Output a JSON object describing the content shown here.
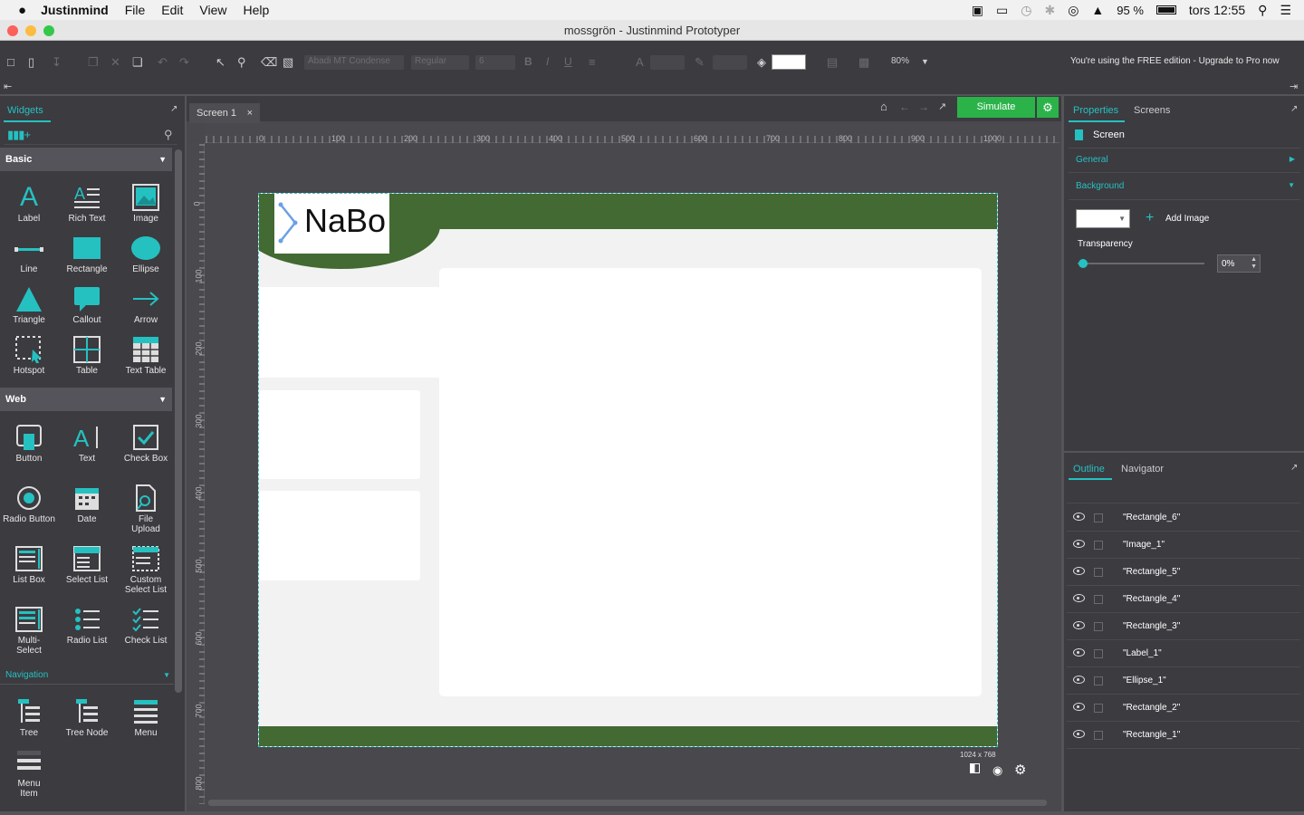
{
  "menubar": {
    "apple_icon": "apple-icon",
    "app": "Justinmind",
    "items": [
      "File",
      "Edit",
      "View",
      "Help"
    ],
    "battery": "95 %",
    "clock": "tors 12:55"
  },
  "window": {
    "title": "mossgrön - Justinmind Prototyper"
  },
  "toolbar": {
    "font_family": "Abadi MT Condense",
    "font_style": "Regular",
    "font_size": "6",
    "bold": "B",
    "italic": "I",
    "underline": "U",
    "font_color_glyph": "A",
    "zoom": "80%",
    "edition_notice": "You're using the FREE edition - Upgrade to Pro now"
  },
  "left_panel": {
    "tab": "Widgets",
    "sections": {
      "basic": "Basic",
      "web": "Web",
      "navigation": "Navigation"
    },
    "basic_widgets": [
      "Label",
      "Rich Text",
      "Image",
      "Line",
      "Rectangle",
      "Ellipse",
      "Triangle",
      "Callout",
      "Arrow",
      "Hotspot",
      "Table",
      "Text Table"
    ],
    "web_widgets": [
      "Button",
      "Text",
      "Check Box",
      "Radio Button",
      "Date",
      "File Upload",
      "List Box",
      "Select List",
      "Custom Select List",
      "Multi-Select",
      "Radio List",
      "Check List"
    ],
    "nav_widgets": [
      "Tree",
      "Tree Node",
      "Menu",
      "Menu Item"
    ]
  },
  "canvas": {
    "tab": "Screen 1",
    "tab_close": "×",
    "simulate": "Simulate",
    "ruler_h": [
      "0",
      "100",
      "200",
      "300",
      "400",
      "500",
      "600",
      "700",
      "800",
      "900",
      "1000"
    ],
    "ruler_v": [
      "0",
      "100",
      "200",
      "300",
      "400",
      "500",
      "600",
      "700",
      "800"
    ],
    "screen_size": "1024 x 768",
    "logo_text": "NaBo",
    "colors": {
      "green": "#426a32",
      "panel": "#ffffff",
      "bg": "#f2f2f2"
    }
  },
  "right_panel": {
    "tabs": [
      "Properties",
      "Screens"
    ],
    "item": "Screen",
    "general": "General",
    "background": "Background",
    "add_image": "Add Image",
    "transparency": "Transparency",
    "transparency_value": "0%"
  },
  "outline": {
    "tabs": [
      "Outline",
      "Navigator"
    ],
    "items": [
      "\"Rectangle_6\"",
      "\"Image_1\"",
      "\"Rectangle_5\"",
      "\"Rectangle_4\"",
      "\"Rectangle_3\"",
      "\"Label_1\"",
      "\"Ellipse_1\"",
      "\"Rectangle_2\"",
      "\"Rectangle_1\""
    ]
  }
}
